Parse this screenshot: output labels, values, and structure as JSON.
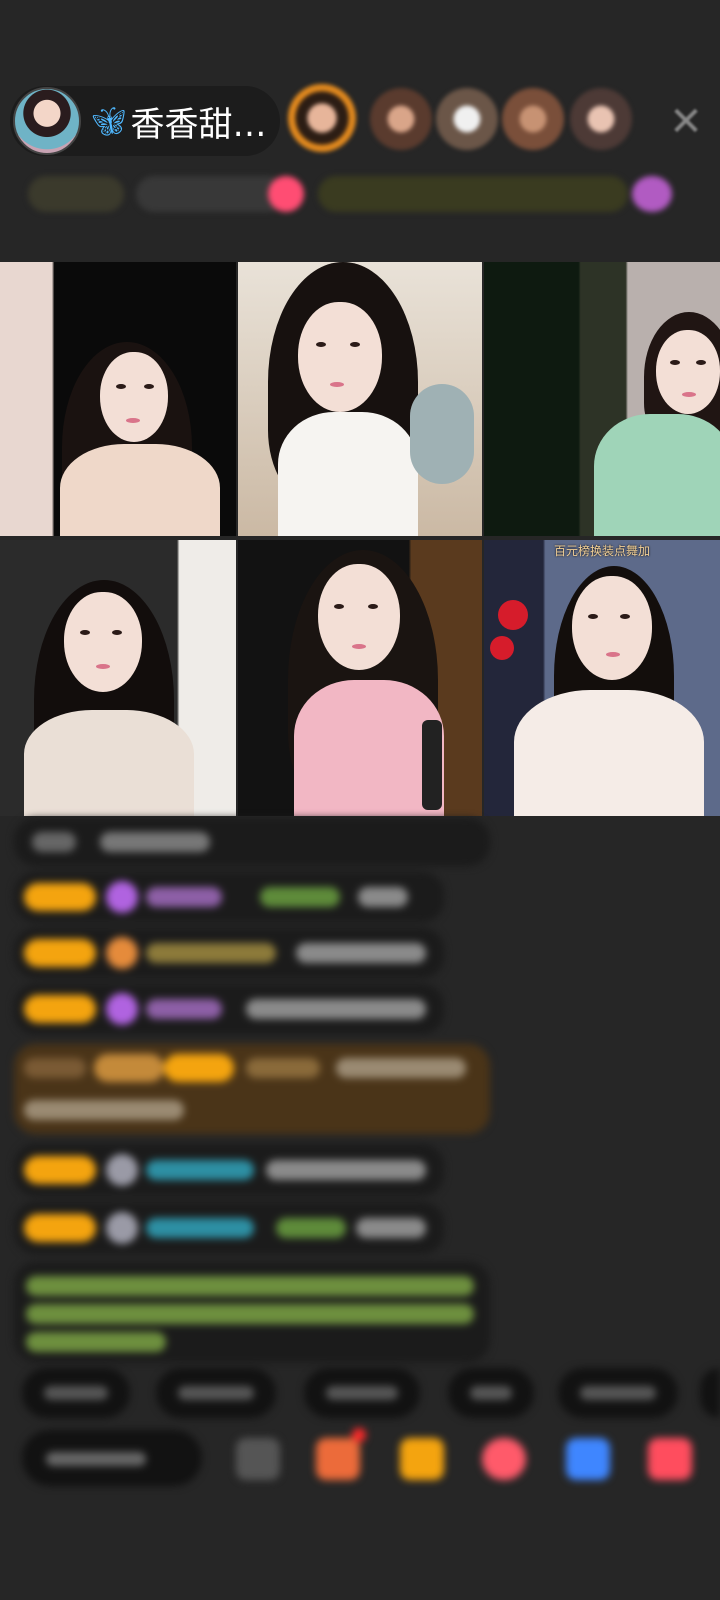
{
  "header": {
    "host_name": "香香甜…",
    "host_icon": "butterfly-icon",
    "close_icon": "close-icon"
  },
  "video_grid": {
    "tile_caption": "百元榜换装点舞加"
  },
  "colors": {
    "background": "#262626",
    "badge": "#f4a40f",
    "chat_green": "#86c24a",
    "chat_cyan": "#2d8fa3",
    "chat_purple": "#b063e0"
  }
}
